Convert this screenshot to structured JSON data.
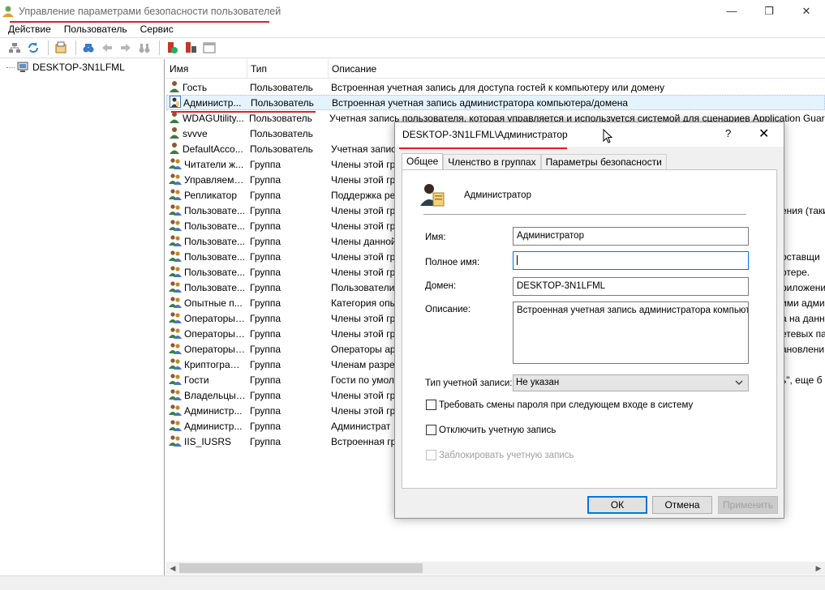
{
  "window": {
    "title": "Управление параметрами безопасности пользователей",
    "minimize": "—",
    "maximize": "❐",
    "close": "✕"
  },
  "menu": [
    "Действие",
    "Пользователь",
    "Сервис"
  ],
  "tree": {
    "root": "DESKTOP-3N1LFML"
  },
  "list": {
    "columns": [
      "Имя",
      "Тип",
      "Описание"
    ],
    "rows": [
      {
        "name": "Гость",
        "type": "Пользователь",
        "desc": "Встроенная учетная запись для доступа гостей к компьютеру или домену",
        "icon": "user"
      },
      {
        "name": "Администр...",
        "type": "Пользователь",
        "desc": "Встроенная учетная запись администратора компьютера/домена",
        "icon": "admin"
      },
      {
        "name": "WDAGUtility...",
        "type": "Пользователь",
        "desc": "Учетная запись пользователя, которая управляется и используется системой для сценариев Application Guard",
        "icon": "user"
      },
      {
        "name": "svvve",
        "type": "Пользователь",
        "desc": "",
        "icon": "user"
      },
      {
        "name": "DefaultAcco...",
        "type": "Пользователь",
        "desc": "Учетная запись",
        "icon": "user"
      },
      {
        "name": "Читатели ж...",
        "type": "Группа",
        "desc": "Члены этой гр",
        "icon": "group"
      },
      {
        "name": "Управляема...",
        "type": "Группа",
        "desc": "Члены этой гр",
        "icon": "group"
      },
      {
        "name": "Репликатор",
        "type": "Группа",
        "desc": "Поддержка реп",
        "icon": "group"
      },
      {
        "name": "Пользовате...",
        "type": "Группа",
        "desc": "Члены этой гр",
        "icon": "group",
        "tail": "ения (таки"
      },
      {
        "name": "Пользовате...",
        "type": "Группа",
        "desc": "Члены этой гр",
        "icon": "group"
      },
      {
        "name": "Пользовате...",
        "type": "Группа",
        "desc": "Члены данной",
        "icon": "group"
      },
      {
        "name": "Пользовате...",
        "type": "Группа",
        "desc": "Члены этой гр",
        "icon": "group",
        "tail": "оставщи"
      },
      {
        "name": "Пользовате...",
        "type": "Группа",
        "desc": "Члены этой гр",
        "icon": "group",
        "tail": "отере."
      },
      {
        "name": "Пользовате...",
        "type": "Группа",
        "desc": "Пользователи",
        "icon": "group",
        "tail": "риложени"
      },
      {
        "name": "Опытные п...",
        "type": "Группа",
        "desc": "Категория опы",
        "icon": "group",
        "tail": "ими адми"
      },
      {
        "name": "Операторы ...",
        "type": "Группа",
        "desc": "Члены этой гр",
        "icon": "group",
        "tail": "а на данн"
      },
      {
        "name": "Операторы ...",
        "type": "Группа",
        "desc": "Члены этой гр",
        "icon": "group",
        "tail": "етевых па"
      },
      {
        "name": "Операторы ...",
        "type": "Группа",
        "desc": "Операторы ар",
        "icon": "group",
        "tail": "ановлени"
      },
      {
        "name": "Криптограф...",
        "type": "Группа",
        "desc": "Членам разре",
        "icon": "group"
      },
      {
        "name": "Гости",
        "type": "Группа",
        "desc": "Гости по умол",
        "icon": "group",
        "tail": "ь\", еще б"
      },
      {
        "name": "Владельцы ...",
        "type": "Группа",
        "desc": "Члены этой гр",
        "icon": "group"
      },
      {
        "name": "Администр...",
        "type": "Группа",
        "desc": "Члены этой гр",
        "icon": "group"
      },
      {
        "name": "Администр...",
        "type": "Группа",
        "desc": "Администрат",
        "icon": "group"
      },
      {
        "name": "IIS_IUSRS",
        "type": "Группа",
        "desc": "Встроенная гр",
        "icon": "group"
      }
    ]
  },
  "dialog": {
    "title": "DESKTOP-3N1LFML\\Администратор",
    "help": "?",
    "close": "✕",
    "tabs": [
      "Общее",
      "Членство в группах",
      "Параметры безопасности"
    ],
    "user_display": "Администратор",
    "fields": {
      "name_label": "Имя:",
      "name_value": "Администратор",
      "fullname_label": "Полное имя:",
      "fullname_value": "",
      "domain_label": "Домен:",
      "domain_value": "DESKTOP-3N1LFML",
      "desc_label": "Описание:",
      "desc_value": "Встроенная учетная запись администратора компьюте",
      "type_label": "Тип учетной записи:",
      "type_value": "Не указан"
    },
    "checks": {
      "pwd_change": "Требовать смены пароля при следующем входе в систему",
      "disable": "Отключить учетную запись",
      "lock": "Заблокировать учетную запись"
    },
    "buttons": {
      "ok": "ОК",
      "cancel": "Отмена",
      "apply": "Применить"
    }
  },
  "colors": {
    "accent": "#0078d7",
    "annotation": "#e02020",
    "selection": "#e5f3ff"
  }
}
